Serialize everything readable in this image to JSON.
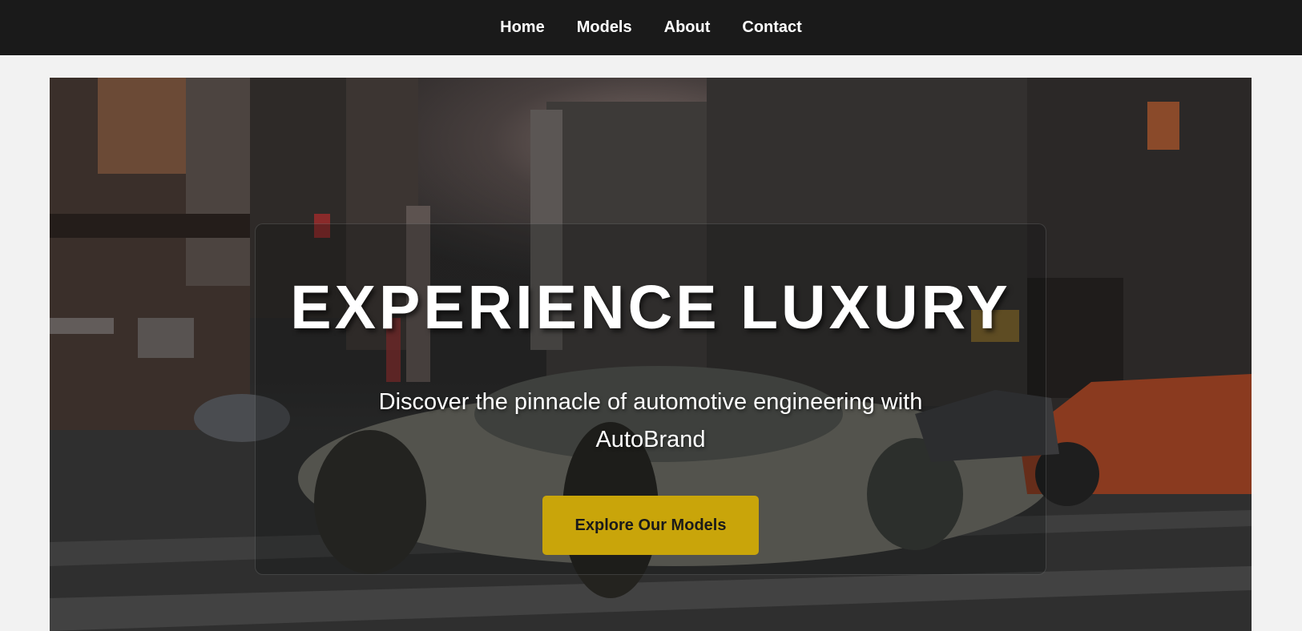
{
  "nav": {
    "items": [
      {
        "label": "Home"
      },
      {
        "label": "Models"
      },
      {
        "label": "About"
      },
      {
        "label": "Contact"
      }
    ]
  },
  "hero": {
    "title": "EXPERIENCE LUXURY",
    "subtitle": "Discover the pinnacle of automotive engineering with AutoBrand",
    "cta_label": "Explore Our Models",
    "background_image": "city-street-sports-car-photo"
  },
  "colors": {
    "nav_background": "#1a1a1a",
    "page_background": "#f2f2f2",
    "accent": "#c9a50a",
    "text_light": "#ffffff"
  }
}
